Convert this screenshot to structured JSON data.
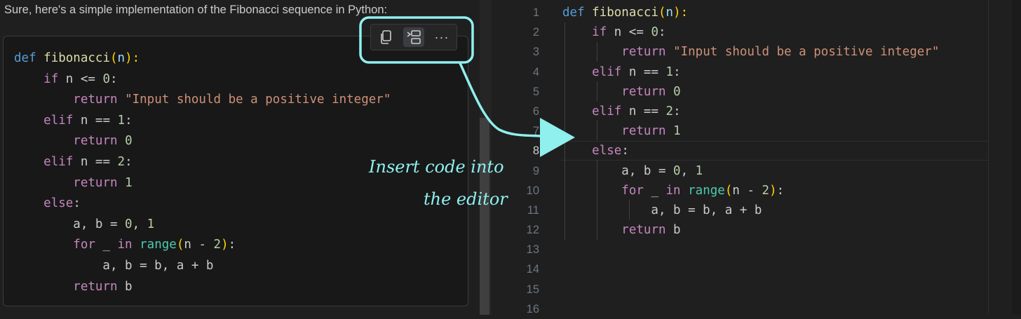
{
  "chat": {
    "intro": "Sure, here's a simple implementation of the Fibonacci sequence in Python:",
    "toolbar": {
      "copy_icon": "copy-icon",
      "insert_icon": "insert-into-editor-icon",
      "more_label": "···"
    },
    "code": [
      [
        [
          "kw",
          "def"
        ],
        [
          "",
          " "
        ],
        [
          "fn",
          "fibonacci"
        ],
        [
          "br",
          "("
        ],
        [
          "par",
          "n"
        ],
        [
          "br",
          "):"
        ]
      ],
      [
        [
          "",
          "    "
        ],
        [
          "ctl",
          "if"
        ],
        [
          "",
          " n <= "
        ],
        [
          "num",
          "0"
        ],
        [
          "",
          ":"
        ]
      ],
      [
        [
          "",
          "        "
        ],
        [
          "ctl",
          "return"
        ],
        [
          "",
          " "
        ],
        [
          "str",
          "\"Input should be a positive integer\""
        ]
      ],
      [
        [
          "",
          "    "
        ],
        [
          "ctl",
          "elif"
        ],
        [
          "",
          " n == "
        ],
        [
          "num",
          "1"
        ],
        [
          "",
          ":"
        ]
      ],
      [
        [
          "",
          "        "
        ],
        [
          "ctl",
          "return"
        ],
        [
          "",
          " "
        ],
        [
          "num",
          "0"
        ]
      ],
      [
        [
          "",
          "    "
        ],
        [
          "ctl",
          "elif"
        ],
        [
          "",
          " n == "
        ],
        [
          "num",
          "2"
        ],
        [
          "",
          ":"
        ]
      ],
      [
        [
          "",
          "        "
        ],
        [
          "ctl",
          "return"
        ],
        [
          "",
          " "
        ],
        [
          "num",
          "1"
        ]
      ],
      [
        [
          "",
          "    "
        ],
        [
          "ctl",
          "else"
        ],
        [
          "",
          ":"
        ]
      ],
      [
        [
          "",
          "        a, b = "
        ],
        [
          "num",
          "0"
        ],
        [
          "",
          ", "
        ],
        [
          "num",
          "1"
        ]
      ],
      [
        [
          "",
          "        "
        ],
        [
          "ctl",
          "for"
        ],
        [
          "",
          " _ "
        ],
        [
          "ctl",
          "in"
        ],
        [
          "",
          " "
        ],
        [
          "bi",
          "range"
        ],
        [
          "br",
          "("
        ],
        [
          "",
          "n - "
        ],
        [
          "num",
          "2"
        ],
        [
          "br",
          ")"
        ],
        [
          "",
          ":"
        ]
      ],
      [
        [
          "",
          "            a, b = b, a + b"
        ]
      ],
      [
        [
          "",
          "        "
        ],
        [
          "ctl",
          "return"
        ],
        [
          "",
          " b"
        ]
      ]
    ]
  },
  "editor": {
    "line_numbers": [
      "1",
      "2",
      "3",
      "4",
      "5",
      "6",
      "7",
      "8",
      "9",
      "10",
      "11",
      "12",
      "13",
      "14",
      "15",
      "16"
    ],
    "active_line": "8",
    "code": [
      [
        [
          "kw",
          "def"
        ],
        [
          "",
          " "
        ],
        [
          "fn",
          "fibonacci"
        ],
        [
          "br",
          "("
        ],
        [
          "par",
          "n"
        ],
        [
          "br",
          "):"
        ]
      ],
      [
        [
          "",
          "    "
        ],
        [
          "ctl",
          "if"
        ],
        [
          "",
          " n <= "
        ],
        [
          "num",
          "0"
        ],
        [
          "",
          ":"
        ]
      ],
      [
        [
          "",
          "        "
        ],
        [
          "ctl",
          "return"
        ],
        [
          "",
          " "
        ],
        [
          "str",
          "\"Input should be a positive integer\""
        ]
      ],
      [
        [
          "",
          "    "
        ],
        [
          "ctl",
          "elif"
        ],
        [
          "",
          " n == "
        ],
        [
          "num",
          "1"
        ],
        [
          "",
          ":"
        ]
      ],
      [
        [
          "",
          "        "
        ],
        [
          "ctl",
          "return"
        ],
        [
          "",
          " "
        ],
        [
          "num",
          "0"
        ]
      ],
      [
        [
          "",
          "    "
        ],
        [
          "ctl",
          "elif"
        ],
        [
          "",
          " n == "
        ],
        [
          "num",
          "2"
        ],
        [
          "",
          ":"
        ]
      ],
      [
        [
          "",
          "        "
        ],
        [
          "ctl",
          "return"
        ],
        [
          "",
          " "
        ],
        [
          "num",
          "1"
        ]
      ],
      [
        [
          "",
          "    "
        ],
        [
          "ctl",
          "else"
        ],
        [
          "",
          ":"
        ]
      ],
      [
        [
          "",
          "        a, b = "
        ],
        [
          "num",
          "0"
        ],
        [
          "",
          ", "
        ],
        [
          "num",
          "1"
        ]
      ],
      [
        [
          "",
          "        "
        ],
        [
          "ctl",
          "for"
        ],
        [
          "",
          " _ "
        ],
        [
          "ctl",
          "in"
        ],
        [
          "",
          " "
        ],
        [
          "bi",
          "range"
        ],
        [
          "br",
          "("
        ],
        [
          "",
          "n - "
        ],
        [
          "num",
          "2"
        ],
        [
          "br",
          ")"
        ],
        [
          "",
          ":"
        ]
      ],
      [
        [
          "",
          "            a, b = b, a + b"
        ]
      ],
      [
        [
          "",
          "        "
        ],
        [
          "ctl",
          "return"
        ],
        [
          "",
          " b"
        ]
      ]
    ]
  },
  "annotation": {
    "line1": "Insert code into",
    "line2": "the editor",
    "color": "#8ff0ee"
  }
}
